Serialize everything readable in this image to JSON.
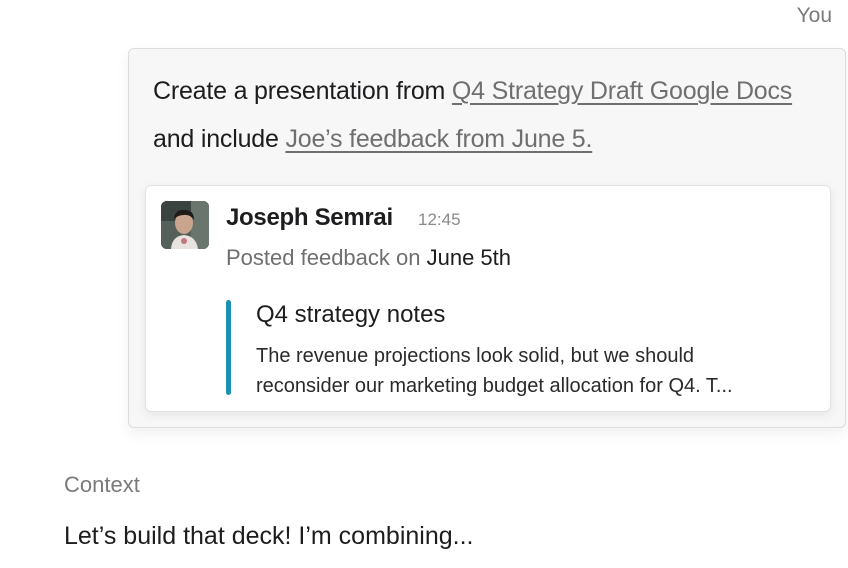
{
  "message": {
    "sender": "You",
    "prompt": {
      "text_before": "Create a presentation from ",
      "link_doc": "Q4 Strategy Draft Google Docs",
      "text_middle": " and include ",
      "link_feedback": "Joe’s feedback from June 5."
    },
    "attachment": {
      "author": "Joseph Semrai",
      "time": "12:45",
      "posted_prefix": "Posted feedback on ",
      "posted_date": "June 5th",
      "quote_title": "Q4 strategy notes",
      "quote_line1": "The revenue projections look solid, but we should",
      "quote_line2": "reconsider our marketing budget allocation for Q4. T..."
    }
  },
  "assistant": {
    "context_label": "Context",
    "response": "Let’s build that deck! I’m combining..."
  },
  "colors": {
    "quote_bar": "#1c8fb3",
    "link": "#6f6f6f",
    "bubble_bg": "#f7f7f7"
  }
}
